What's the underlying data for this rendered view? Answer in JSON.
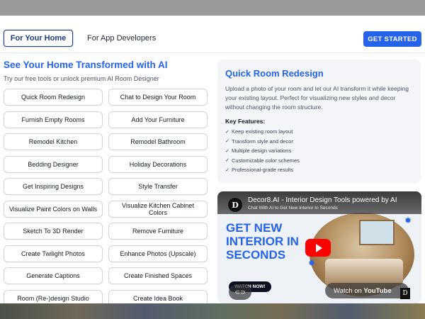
{
  "nav": {
    "tab_home": "For Your Home",
    "tab_developers": "For App Developers",
    "cta": "GET STARTED"
  },
  "hero": {
    "title": "See Your Home Transformed with AI",
    "subtitle": "Try our free tools or unlock premium AI Room Designer"
  },
  "tools": [
    "Quick Room Redesign",
    "Chat to Design Your Room",
    "Furnish Empty Rooms",
    "Add Your Furniture",
    "Remodel Kitchen",
    "Remodel Bathroom",
    "Bedding Designer",
    "Holiday Decorations",
    "Get Inspiring Designs",
    "Style Transfer",
    "Visualize Paint Colors on Walls",
    "Visualize Kitchen Cabinet Colors",
    "Sketch To 3D Render",
    "Remove Furniture",
    "Create Twilight Photos",
    "Enhance Photos (Upscale)",
    "Generate Captions",
    "Create Finished Spaces",
    "Room (Re-)design Studio",
    "Create Idea Book"
  ],
  "panel": {
    "title": "Quick Room Redesign",
    "description": "Upload a photo of your room and let our AI transform it while keeping your existing layout. Perfect for visualizing new styles and decor without changing the room structure.",
    "key_features_title": "Key Features:",
    "features": [
      "Keep existing room layout",
      "Transform style and decor",
      "Multiple design variations",
      "Customizable color schemes",
      "Professional-grade results"
    ]
  },
  "video": {
    "channel_initial": "D",
    "title": "Decor8.AI - Interior Design Tools powered by AI",
    "subtitle": "Chat With AI to Get New Interior In Seconds",
    "thumb_text": "GET NEW INTERIOR IN SECONDS",
    "watch_now": "WATCH NOW!",
    "watch_on": "Watch on",
    "youtube": "YouTube",
    "logo_initial": "D"
  },
  "colors": {
    "accent": "#2563eb",
    "nav_active_border": "#1e3a8a",
    "youtube_red": "#ff0000"
  }
}
